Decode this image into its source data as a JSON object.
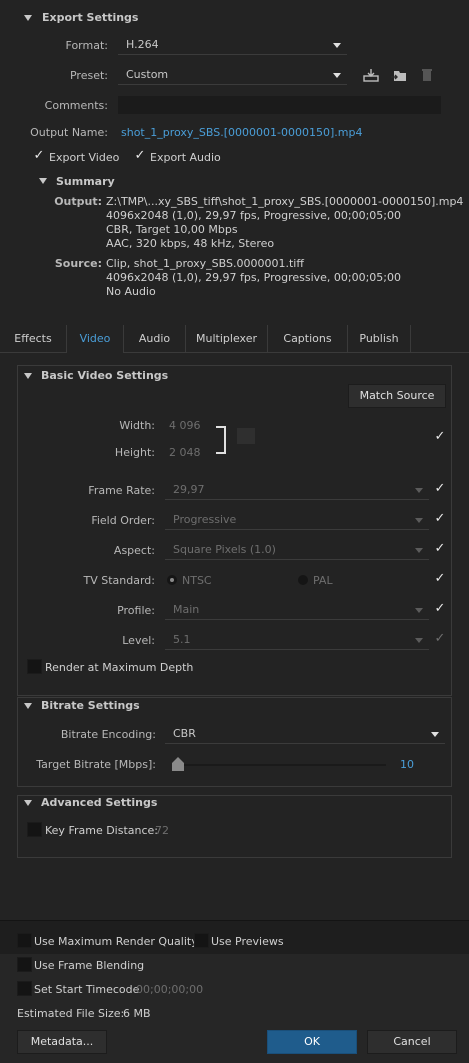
{
  "export_settings": {
    "title": "Export Settings",
    "format_label": "Format:",
    "format_value": "H.264",
    "preset_label": "Preset:",
    "preset_value": "Custom",
    "comments_label": "Comments:",
    "comments_value": "",
    "output_name_label": "Output Name:",
    "output_name_value": "shot_1_proxy_SBS.[0000001-0000150].mp4",
    "export_video_label": "Export Video",
    "export_audio_label": "Export Audio",
    "export_video_checked": true,
    "export_audio_checked": true
  },
  "summary": {
    "title": "Summary",
    "output_label": "Output:",
    "output_lines": [
      "Z:\\TMP\\...xy_SBS_tiff\\shot_1_proxy_SBS.[0000001-0000150].mp4",
      "4096x2048 (1,0), 29,97 fps, Progressive, 00;00;05;00",
      "CBR, Target 10,00 Mbps",
      "AAC, 320 kbps, 48 kHz, Stereo"
    ],
    "source_label": "Source:",
    "source_lines": [
      "Clip, shot_1_proxy_SBS.0000001.tiff",
      "4096x2048 (1,0), 29,97 fps, Progressive, 00;00;05;00",
      "No Audio"
    ]
  },
  "tabs": [
    "Effects",
    "Video",
    "Audio",
    "Multiplexer",
    "Captions",
    "Publish"
  ],
  "active_tab": "Video",
  "basic_video": {
    "title": "Basic Video Settings",
    "match_source_label": "Match Source",
    "width_label": "Width:",
    "width_value": "4 096",
    "height_label": "Height:",
    "height_value": "2 048",
    "frame_rate_label": "Frame Rate:",
    "frame_rate_value": "29,97",
    "field_order_label": "Field Order:",
    "field_order_value": "Progressive",
    "aspect_label": "Aspect:",
    "aspect_value": "Square Pixels (1.0)",
    "tv_standard_label": "TV Standard:",
    "ntsc_label": "NTSC",
    "pal_label": "PAL",
    "profile_label": "Profile:",
    "profile_value": "Main",
    "level_label": "Level:",
    "level_value": "5.1",
    "render_max_depth_label": "Render at Maximum Depth"
  },
  "bitrate": {
    "title": "Bitrate Settings",
    "encoding_label": "Bitrate Encoding:",
    "encoding_value": "CBR",
    "target_label": "Target Bitrate [Mbps]:",
    "target_value": "10",
    "slider_fraction": 0.0
  },
  "advanced": {
    "title": "Advanced Settings",
    "key_frame_label": "Key Frame Distance:",
    "key_frame_value": "72"
  },
  "bottom": {
    "max_render_quality_label": "Use Maximum Render Quality",
    "use_previews_label": "Use Previews",
    "frame_blending_label": "Use Frame Blending",
    "start_timecode_label": "Set Start Timecode",
    "start_timecode_value": "00;00;00;00",
    "file_size_label": "Estimated File Size:",
    "file_size_value": "6 MB",
    "metadata_label": "Metadata...",
    "ok_label": "OK",
    "cancel_label": "Cancel"
  },
  "colors": {
    "accent": "#4a9ed8",
    "ok_button": "#1f5c8c",
    "background": "#232323"
  }
}
